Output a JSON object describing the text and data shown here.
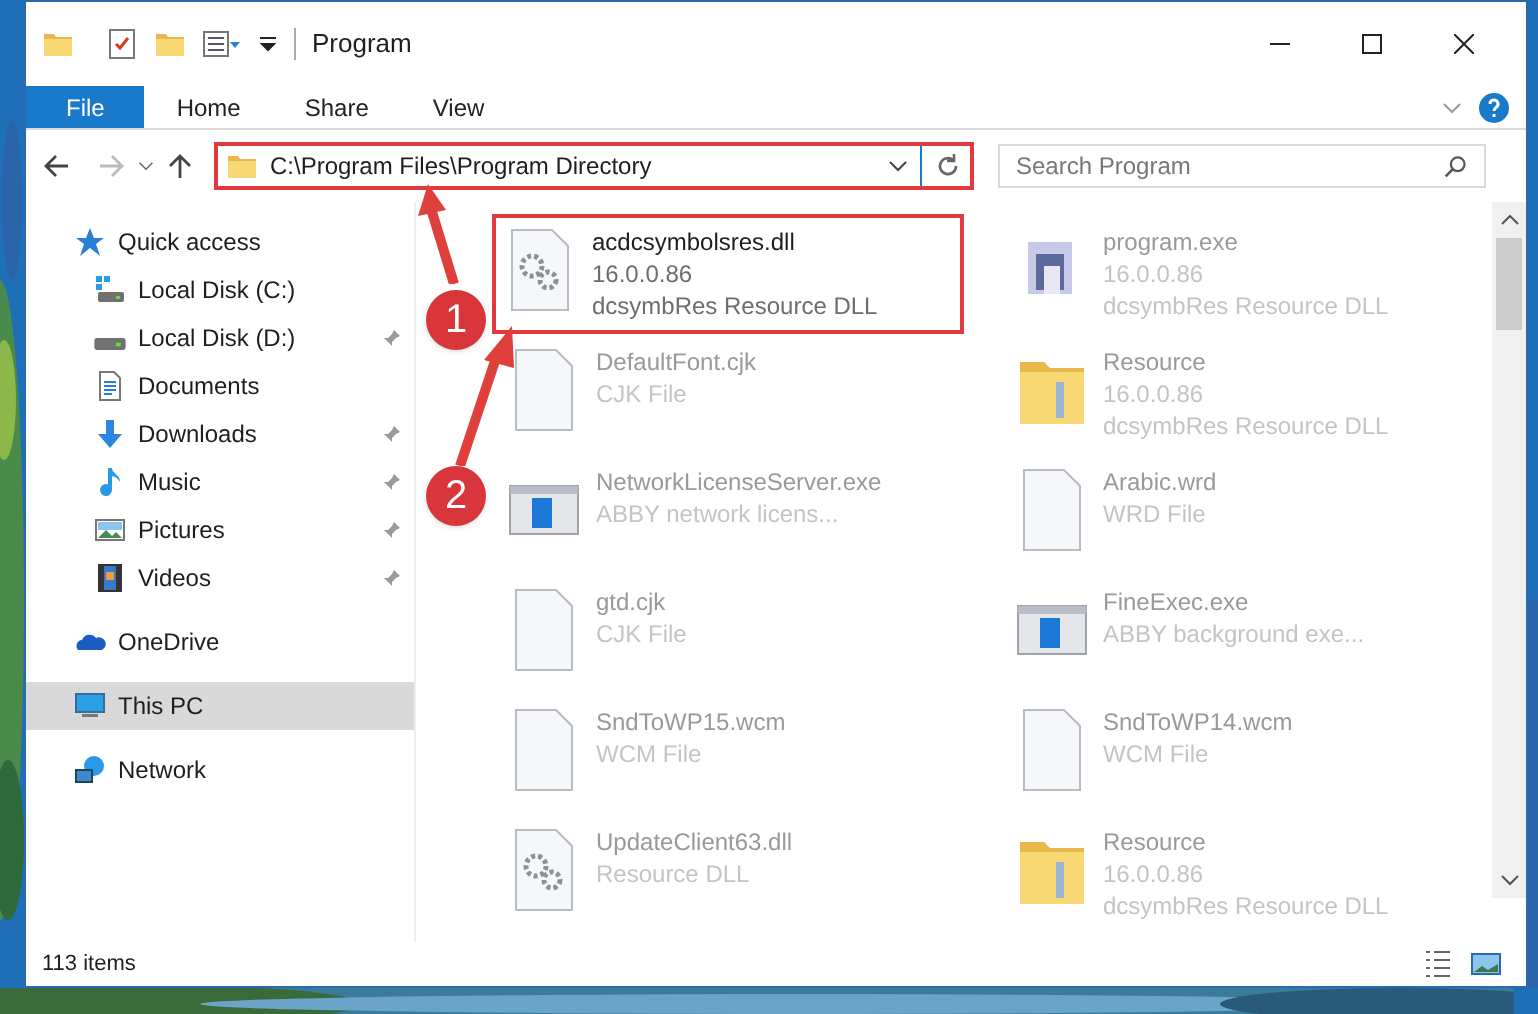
{
  "window": {
    "title": "Program"
  },
  "ribbon_tabs": [
    {
      "label": "File",
      "selected": true
    },
    {
      "label": "Home",
      "selected": false
    },
    {
      "label": "Share",
      "selected": false
    },
    {
      "label": "View",
      "selected": false
    }
  ],
  "address_bar": {
    "path": "C:\\Program Files\\Program Directory"
  },
  "search": {
    "placeholder": "Search Program"
  },
  "sidebar": {
    "items": [
      {
        "label": "Quick access",
        "kind": "star",
        "pinned": false,
        "selected": false
      },
      {
        "label": "Local Disk (C:)",
        "kind": "disk-c",
        "pinned": false,
        "selected": false
      },
      {
        "label": "Local Disk (D:)",
        "kind": "disk",
        "pinned": true,
        "selected": false
      },
      {
        "label": "Documents",
        "kind": "documents",
        "pinned": false,
        "selected": false
      },
      {
        "label": "Downloads",
        "kind": "downloads",
        "pinned": true,
        "selected": false
      },
      {
        "label": "Music",
        "kind": "music",
        "pinned": true,
        "selected": false
      },
      {
        "label": "Pictures",
        "kind": "pictures",
        "pinned": true,
        "selected": false
      },
      {
        "label": "Videos",
        "kind": "videos",
        "pinned": true,
        "selected": false
      },
      {
        "label": "OneDrive",
        "kind": "cloud",
        "pinned": false,
        "selected": false
      },
      {
        "label": "This PC",
        "kind": "pc",
        "pinned": false,
        "selected": true
      },
      {
        "label": "Network",
        "kind": "network",
        "pinned": false,
        "selected": false
      }
    ]
  },
  "files": [
    {
      "name": "acdcsymbolsres.dll",
      "details": [
        "16.0.0.86",
        "dcsymbRes Resource DLL"
      ],
      "kind": "dll",
      "highlighted": true
    },
    {
      "name": "program.exe",
      "details": [
        "16.0.0.86",
        "dcsymbRes Resource DLL"
      ],
      "kind": "exe",
      "highlighted": false
    },
    {
      "name": "DefaultFont.cjk",
      "details": [
        "CJK File"
      ],
      "kind": "file",
      "highlighted": false
    },
    {
      "name": "Resource",
      "details": [
        "16.0.0.86",
        "dcsymbRes Resource DLL"
      ],
      "kind": "folder",
      "highlighted": false
    },
    {
      "name": "NetworkLicenseServer.exe",
      "details": [
        "ABBY network licens..."
      ],
      "kind": "app",
      "highlighted": false
    },
    {
      "name": "Arabic.wrd",
      "details": [
        "WRD File"
      ],
      "kind": "file",
      "highlighted": false
    },
    {
      "name": "gtd.cjk",
      "details": [
        "CJK File"
      ],
      "kind": "file",
      "highlighted": false
    },
    {
      "name": "FineExec.exe",
      "details": [
        "ABBY background exe..."
      ],
      "kind": "app",
      "highlighted": false
    },
    {
      "name": "SndToWP15.wcm",
      "details": [
        "WCM File"
      ],
      "kind": "file",
      "highlighted": false
    },
    {
      "name": "SndToWP14.wcm",
      "details": [
        "WCM File"
      ],
      "kind": "file",
      "highlighted": false
    },
    {
      "name": "UpdateClient63.dll",
      "details": [
        "Resource DLL"
      ],
      "kind": "dll",
      "highlighted": false
    },
    {
      "name": "Resource",
      "details": [
        "16.0.0.86",
        "dcsymbRes Resource DLL"
      ],
      "kind": "folder",
      "highlighted": false
    }
  ],
  "annotations": [
    {
      "label": "1"
    },
    {
      "label": "2"
    }
  ],
  "status_bar": {
    "item_count": "113 items"
  }
}
